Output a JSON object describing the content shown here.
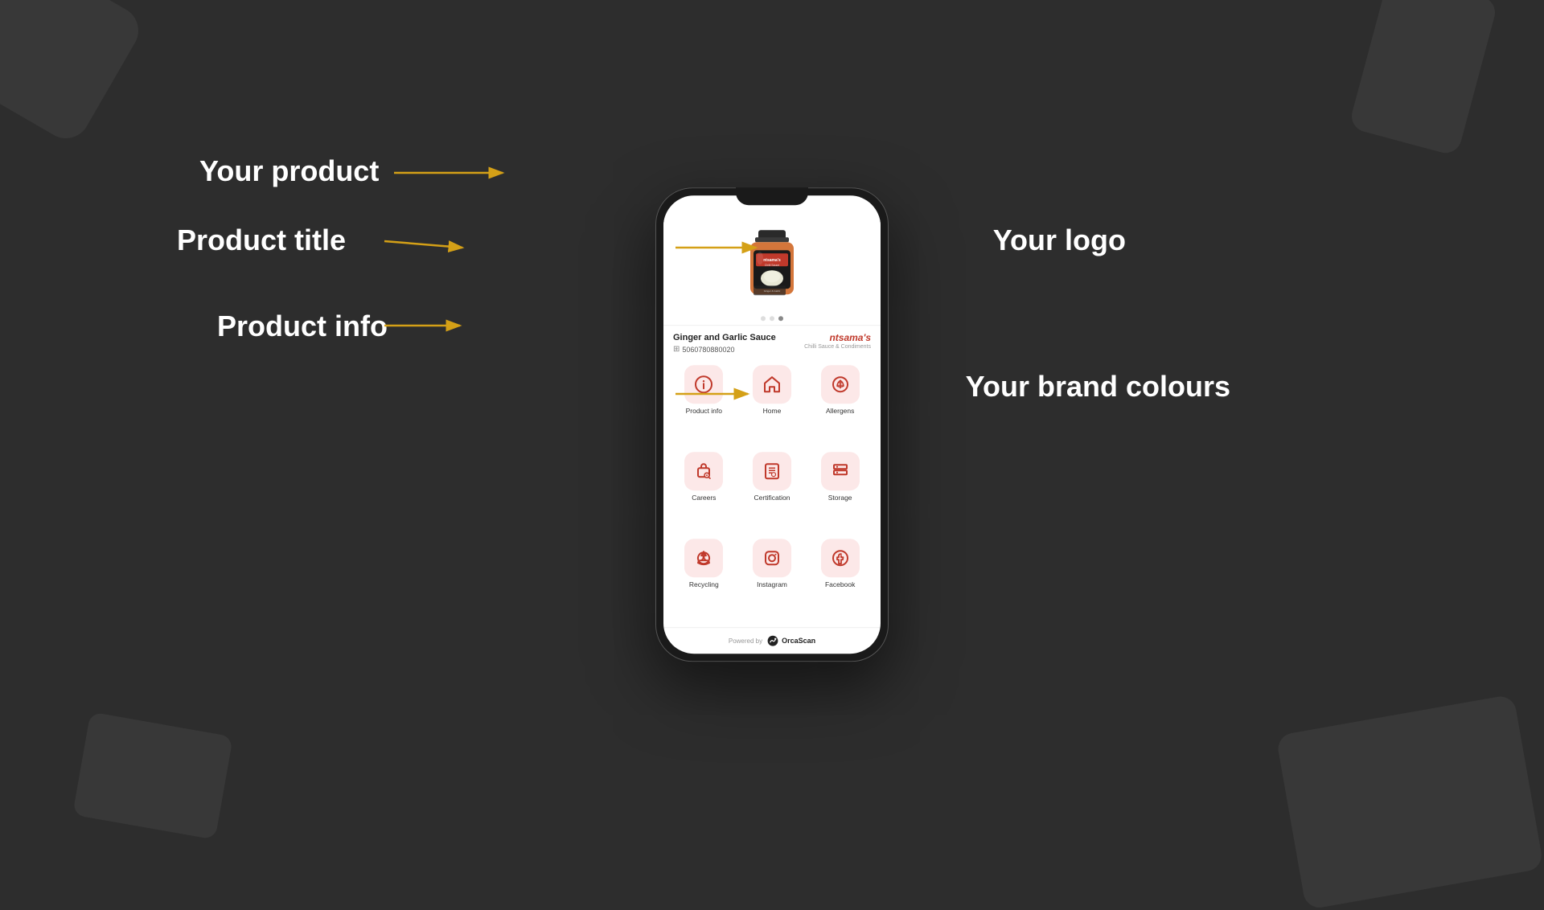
{
  "background": {
    "color": "#2d2d2d"
  },
  "labels": {
    "your_product": "Your product",
    "product_title": "Product title",
    "product_info": "Product info",
    "your_logo": "Your logo",
    "your_brand_colours": "Your brand colours"
  },
  "phone": {
    "product_name": "Ginger and Garlic Sauce",
    "barcode_number": "5060780880020",
    "brand_name": "ntsama's",
    "brand_subtitle": "Chilli Sauce & Condiments",
    "image_dots": [
      {
        "active": false
      },
      {
        "active": false
      },
      {
        "active": true
      }
    ],
    "icons": [
      {
        "label": "Product info",
        "icon": "ℹ",
        "symbol": "info"
      },
      {
        "label": "Home",
        "icon": "🏠",
        "symbol": "home"
      },
      {
        "label": "Allergens",
        "icon": "🔄",
        "symbol": "allergens"
      },
      {
        "label": "Careers",
        "icon": "🔍",
        "symbol": "careers"
      },
      {
        "label": "Certification",
        "icon": "📋",
        "symbol": "certification"
      },
      {
        "label": "Storage",
        "icon": "📦",
        "symbol": "storage"
      },
      {
        "label": "Recycling",
        "icon": "♻",
        "symbol": "recycling"
      },
      {
        "label": "Instagram",
        "icon": "📷",
        "symbol": "instagram"
      },
      {
        "label": "Facebook",
        "icon": "f",
        "symbol": "facebook"
      }
    ],
    "footer": {
      "powered_by": "Powered by",
      "brand": "OrcaScan"
    }
  }
}
